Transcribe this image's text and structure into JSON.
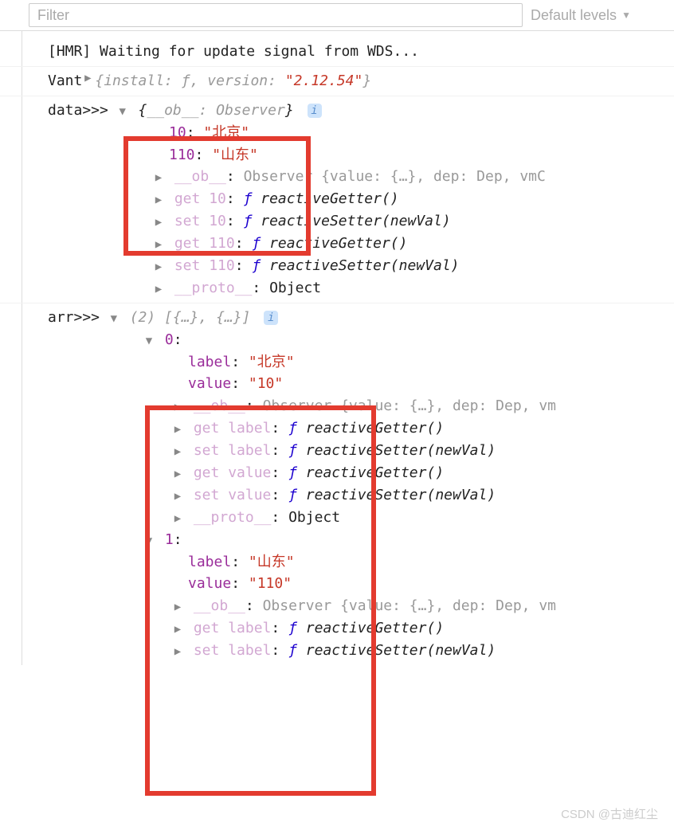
{
  "toolbar": {
    "filter_placeholder": "Filter",
    "levels_label": "Default levels"
  },
  "logs": {
    "hmr": "[HMR] Waiting for update signal from WDS...",
    "vant_prefix": "Vant ",
    "vant_obj_open": "{",
    "vant_install_key": "install: ",
    "vant_f": "ƒ",
    "vant_sep": ", ",
    "vant_version_key": "version: ",
    "vant_version_val": "\"2.12.54\"",
    "vant_obj_close": "}"
  },
  "data_block": {
    "label": "data>>> ",
    "header_open": "{",
    "header_key": "__ob__",
    "header_sep": ": ",
    "header_val": "Observer",
    "header_close": "}",
    "k10": "10",
    "v10": "\"北京\"",
    "k110": "110",
    "v110": "\"山东\"",
    "ob_key": "__ob__",
    "ob_val": "Observer {value: {…}, dep: Dep, vmC",
    "get10": "get 10",
    "set10": "set 10",
    "get110": "get 110",
    "set110": "set 110",
    "getter_sig": "reactiveGetter()",
    "setter_sig": "reactiveSetter(newVal)",
    "proto_key": "__proto__",
    "proto_val": "Object"
  },
  "arr_block": {
    "label": "arr>>> ",
    "header": "(2) [{…}, {…}]",
    "i0": "0",
    "i1": "1",
    "label_key": "label",
    "value_key": "value",
    "v0_label": "\"北京\"",
    "v0_value": "\"10\"",
    "v1_label": "\"山东\"",
    "v1_value": "\"110\"",
    "ob_key": "__ob__",
    "ob_val0": "Observer {value: {…}, dep: Dep, vm",
    "ob_val1": "Observer {value: {…}, dep: Dep, vm",
    "get_label": "get label",
    "set_label": "set label",
    "get_value": "get value",
    "set_value": "set value",
    "getter_sig": "reactiveGetter()",
    "setter_sig": "reactiveSetter(newVal)",
    "proto_key": "__proto__",
    "proto_val": "Object"
  },
  "common": {
    "colon": ": ",
    "f_italic": "ƒ "
  },
  "watermark": "CSDN @古迪红尘"
}
